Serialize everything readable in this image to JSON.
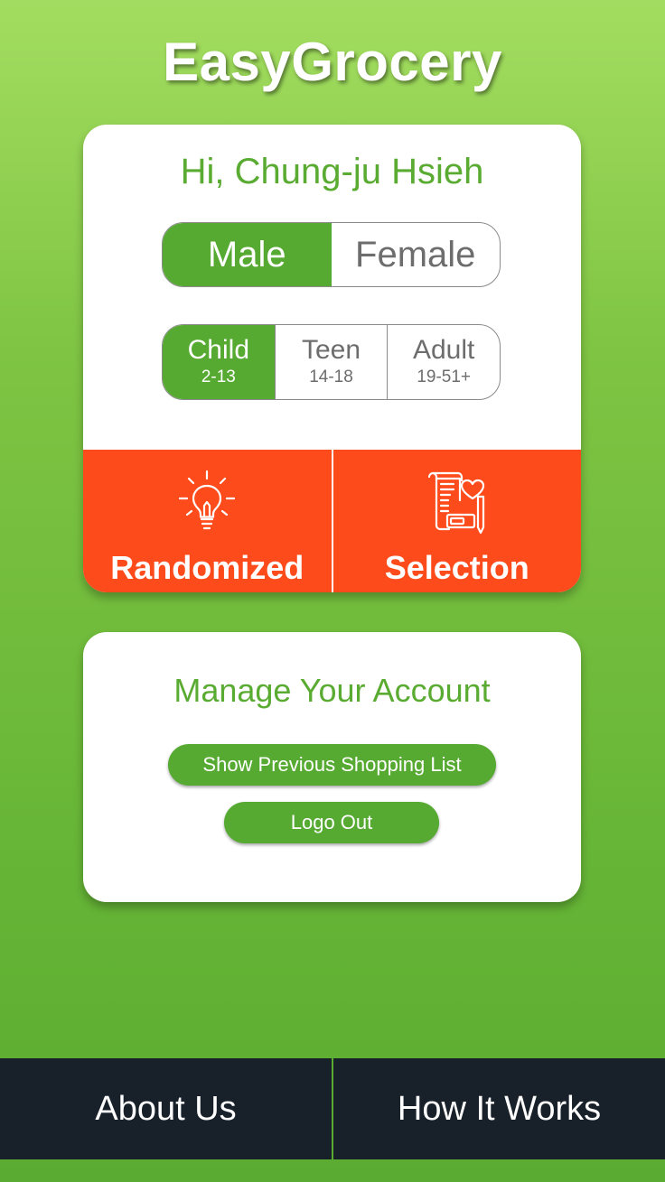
{
  "app": {
    "title": "EasyGrocery"
  },
  "profile": {
    "greeting": "Hi, Chung-ju Hsieh",
    "gender": {
      "options": [
        "Male",
        "Female"
      ],
      "selected": "Male"
    },
    "age": {
      "options": [
        {
          "label": "Child",
          "range": "2-13"
        },
        {
          "label": "Teen",
          "range": "14-18"
        },
        {
          "label": "Adult",
          "range": "19-51+"
        }
      ],
      "selected": "Child"
    }
  },
  "actions": {
    "randomized": {
      "label": "Randomized",
      "icon": "lightbulb-icon"
    },
    "selection": {
      "label": "Selection",
      "icon": "list-heart-icon"
    }
  },
  "account": {
    "title": "Manage Your Account",
    "show_previous_label": "Show Previous Shopping List",
    "logout_label": "Logo Out"
  },
  "bottom_nav": {
    "about_label": "About Us",
    "how_label": "How It Works"
  },
  "colors": {
    "accent_green": "#56aa32",
    "action_orange": "#fe4b1c",
    "bottom_bar": "#18212a"
  }
}
